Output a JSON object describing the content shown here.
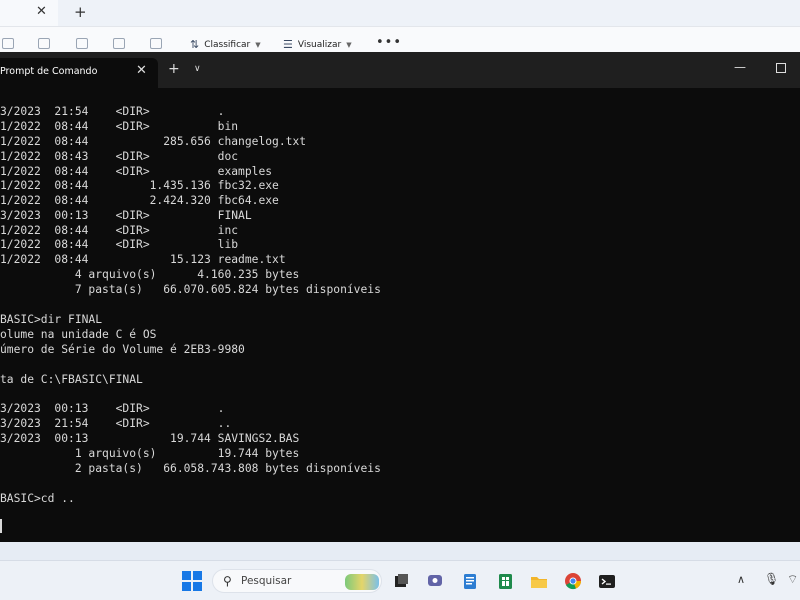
{
  "explorer": {
    "toolbar": {
      "sort_label": "Classificar",
      "view_label": "Visualizar"
    }
  },
  "terminal": {
    "tab_title": "Prompt de Comando",
    "lines": [
      "3/2023  21:54    <DIR>          .",
      "1/2022  08:44    <DIR>          bin",
      "1/2022  08:44           285.656 changelog.txt",
      "1/2022  08:43    <DIR>          doc",
      "1/2022  08:44    <DIR>          examples",
      "1/2022  08:44         1.435.136 fbc32.exe",
      "1/2022  08:44         2.424.320 fbc64.exe",
      "3/2023  00:13    <DIR>          FINAL",
      "1/2022  08:44    <DIR>          inc",
      "1/2022  08:44    <DIR>          lib",
      "1/2022  08:44            15.123 readme.txt",
      "           4 arquivo(s)      4.160.235 bytes",
      "           7 pasta(s)   66.070.605.824 bytes disponíveis",
      "",
      "BASIC>dir FINAL",
      "olume na unidade C é OS",
      "úmero de Série do Volume é 2EB3-9980",
      "",
      "ta de C:\\FBASIC\\FINAL",
      "",
      "3/2023  00:13    <DIR>          .",
      "3/2023  21:54    <DIR>          ..",
      "3/2023  00:13            19.744 SAVINGS2.BAS",
      "           1 arquivo(s)         19.744 bytes",
      "           2 pasta(s)   66.058.743.808 bytes disponíveis",
      "",
      "BASIC>cd .."
    ]
  },
  "taskbar": {
    "search_placeholder": "Pesquisar",
    "icons": [
      "start-icon",
      "task-view-icon",
      "teams-icon",
      "notepad-icon",
      "excel-icon",
      "file-explorer-icon",
      "chrome-icon",
      "terminal-icon"
    ]
  },
  "tray": {
    "icons": [
      "chevron-up-icon",
      "microphone-icon",
      "wifi-icon"
    ]
  },
  "colors": {
    "terminal_bg": "#0c0c0c",
    "terminal_text": "#d9d9d9",
    "titlebar": "#1f1f1f",
    "taskbar": "#edf1f7"
  }
}
